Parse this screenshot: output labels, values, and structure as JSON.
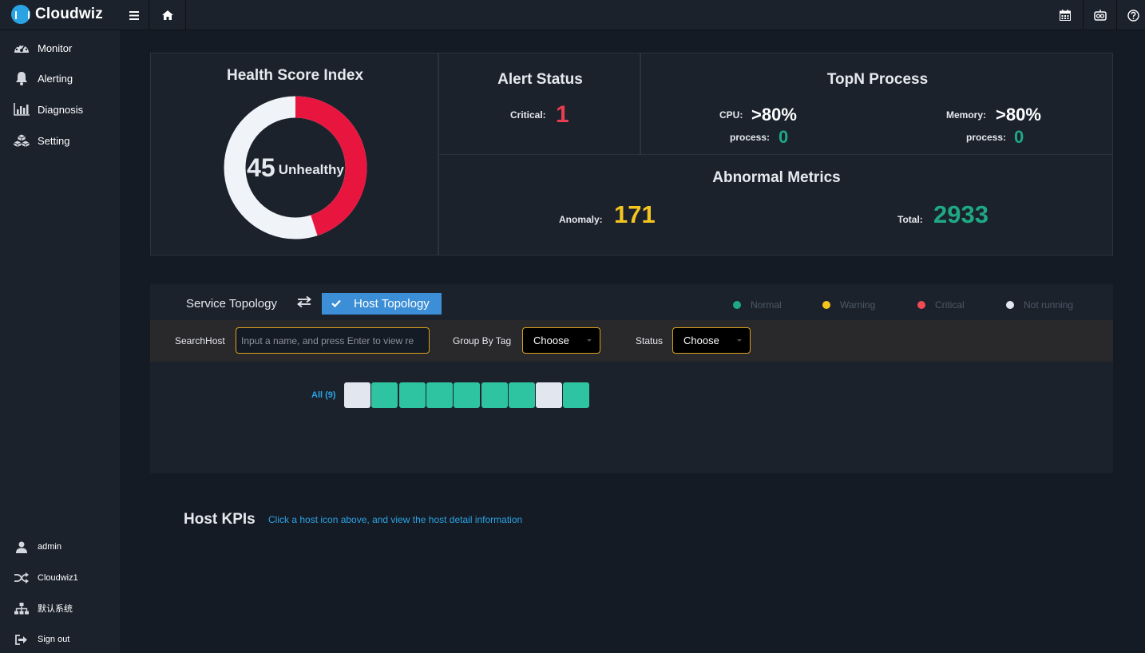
{
  "app": {
    "brand": "Cloudwiz"
  },
  "topbar": {
    "menu_icon": "menu-icon",
    "home_icon": "home-icon",
    "right_icons": [
      "calendar-icon",
      "robot-icon",
      "help-icon"
    ]
  },
  "sidebar": {
    "items": [
      {
        "label": "Monitor",
        "icon": "dashboard-icon"
      },
      {
        "label": "Alerting",
        "icon": "bell-icon"
      },
      {
        "label": "Diagnosis",
        "icon": "bar-chart-icon"
      },
      {
        "label": "Setting",
        "icon": "cubes-icon"
      }
    ],
    "bottom_items": [
      {
        "label": "admin",
        "icon": "user-icon"
      },
      {
        "label": "Cloudwiz1",
        "icon": "shuffle-icon"
      },
      {
        "label": "默认系统",
        "icon": "sitemap-icon"
      },
      {
        "label": "Sign out",
        "icon": "sign-out-icon"
      }
    ]
  },
  "health": {
    "title": "Health Score Index",
    "score": 45,
    "status": "Unhealthy",
    "colors": {
      "filled": "#e8163f",
      "empty": "#f0f3f7"
    }
  },
  "alert_status": {
    "title": "Alert Status",
    "critical_label": "Critical:",
    "critical_value": "1",
    "critical_color": "#e83d50"
  },
  "topn": {
    "title": "TopN Process",
    "cpu_label": "CPU:",
    "cpu_value": ">80%",
    "cpu_process_label": "process:",
    "cpu_process_value": "0",
    "memory_label": "Memory:",
    "memory_value": ">80%",
    "memory_process_label": "process:",
    "memory_process_value": "0",
    "process_color": "#1fa884"
  },
  "abnormal": {
    "title": "Abnormal Metrics",
    "anomaly_label": "Anomaly:",
    "anomaly_value": "171",
    "anomaly_color": "#f4c51f",
    "total_label": "Total:",
    "total_value": "2933",
    "total_color": "#1fa884"
  },
  "topology": {
    "tabs": {
      "service": "Service Topology",
      "host": "Host Topology"
    },
    "legend": [
      {
        "label": "Normal",
        "color": "#1fa884"
      },
      {
        "label": "Warning",
        "color": "#f4c51f"
      },
      {
        "label": "Critical",
        "color": "#ef4b54"
      },
      {
        "label": "Not running",
        "color": "#e2e6ee"
      }
    ],
    "filters": {
      "search_label": "SearchHost",
      "search_placeholder": "Input a name, and press Enter to view re",
      "group_label": "Group By Tag",
      "group_value": "Choose",
      "status_label": "Status",
      "status_value": "Choose"
    },
    "all_label": "All (9)",
    "hosts": [
      {
        "status": "not-running"
      },
      {
        "status": "normal"
      },
      {
        "status": "normal"
      },
      {
        "status": "normal"
      },
      {
        "status": "normal"
      },
      {
        "status": "normal"
      },
      {
        "status": "normal"
      },
      {
        "status": "not-running"
      },
      {
        "status": "normal"
      }
    ],
    "host_colors": {
      "normal": "#2ec4a1",
      "not-running": "#e2e6ee"
    }
  },
  "kpis": {
    "title": "Host KPIs",
    "hint": "Click a host icon above, and view the host detail information"
  }
}
